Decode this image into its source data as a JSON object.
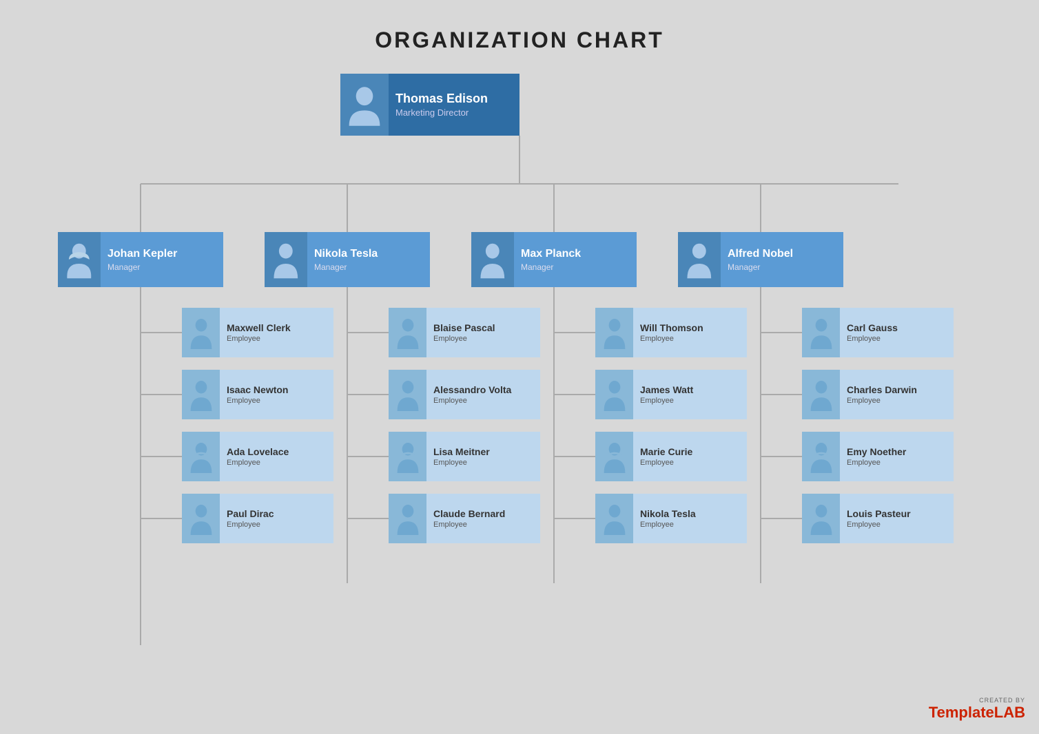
{
  "title": "ORGANIZATION CHART",
  "director": {
    "name": "Thomas Edison",
    "role": "Marketing Director",
    "gender": "male"
  },
  "managers": [
    {
      "name": "Johan Kepler",
      "role": "Manager",
      "gender": "female"
    },
    {
      "name": "Nikola Tesla",
      "role": "Manager",
      "gender": "male"
    },
    {
      "name": "Max Planck",
      "role": "Manager",
      "gender": "male"
    },
    {
      "name": "Alfred Nobel",
      "role": "Manager",
      "gender": "male"
    }
  ],
  "employees": [
    [
      {
        "name": "Maxwell Clerk",
        "role": "Employee",
        "gender": "male"
      },
      {
        "name": "Isaac Newton",
        "role": "Employee",
        "gender": "male"
      },
      {
        "name": "Ada Lovelace",
        "role": "Employee",
        "gender": "female"
      },
      {
        "name": "Paul Dirac",
        "role": "Employee",
        "gender": "male"
      }
    ],
    [
      {
        "name": "Blaise Pascal",
        "role": "Employee",
        "gender": "male"
      },
      {
        "name": "Alessandro Volta",
        "role": "Employee",
        "gender": "male"
      },
      {
        "name": "Lisa Meitner",
        "role": "Employee",
        "gender": "female"
      },
      {
        "name": "Claude Bernard",
        "role": "Employee",
        "gender": "male"
      }
    ],
    [
      {
        "name": "Will Thomson",
        "role": "Employee",
        "gender": "male"
      },
      {
        "name": "James Watt",
        "role": "Employee",
        "gender": "male"
      },
      {
        "name": "Marie Curie",
        "role": "Employee",
        "gender": "female"
      },
      {
        "name": "Nikola Tesla",
        "role": "Employee",
        "gender": "male"
      }
    ],
    [
      {
        "name": "Carl Gauss",
        "role": "Employee",
        "gender": "male"
      },
      {
        "name": "Charles Darwin",
        "role": "Employee",
        "gender": "male"
      },
      {
        "name": "Emy Noether",
        "role": "Employee",
        "gender": "female"
      },
      {
        "name": "Louis Pasteur",
        "role": "Employee",
        "gender": "male"
      }
    ]
  ],
  "watermark": {
    "created_by": "CREATED BY",
    "brand": "Template",
    "brand_accent": "LAB"
  }
}
